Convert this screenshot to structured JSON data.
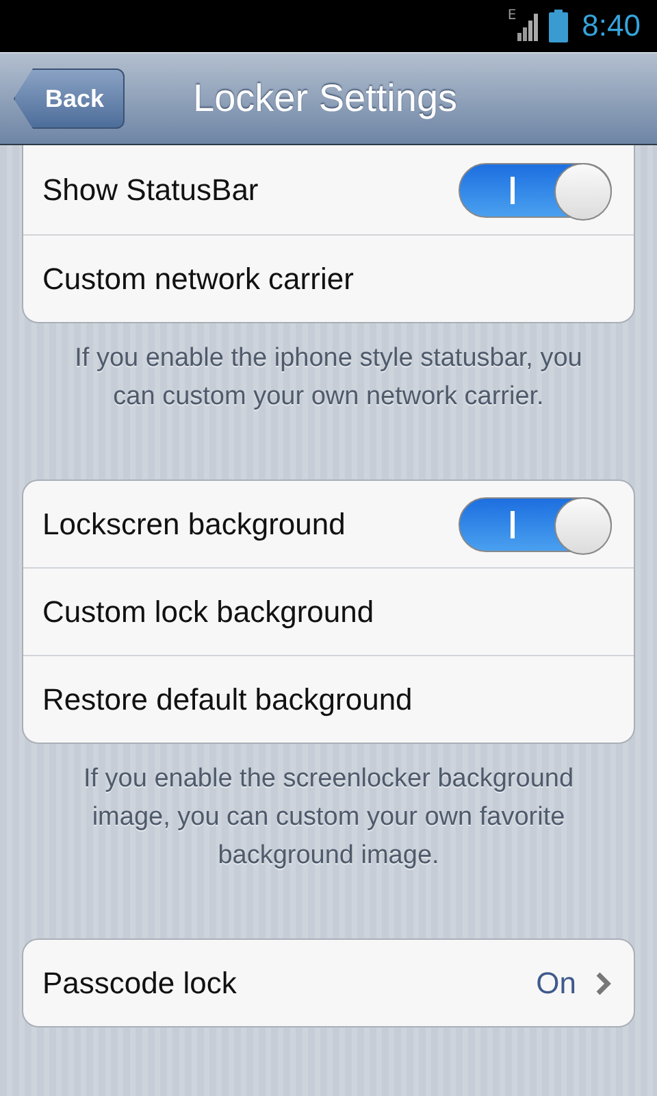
{
  "status_bar": {
    "network": "E",
    "time": "8:40"
  },
  "nav_bar": {
    "back": "Back",
    "title": "Locker Settings"
  },
  "groups": [
    {
      "cut_top": true,
      "rows": [
        {
          "kind": "toggle",
          "label": "Show StatusBar",
          "on": true
        },
        {
          "kind": "link",
          "label": "Custom network carrier"
        }
      ],
      "footer": "If you enable the iphone style statusbar, you can custom your own network carrier."
    },
    {
      "cut_top": false,
      "rows": [
        {
          "kind": "toggle",
          "label": "Lockscren background",
          "on": true
        },
        {
          "kind": "link",
          "label": "Custom lock background"
        },
        {
          "kind": "link",
          "label": "Restore default background"
        }
      ],
      "footer": "If you enable the screenlocker background image, you can custom your own favorite background image."
    },
    {
      "cut_top": false,
      "rows": [
        {
          "kind": "value",
          "label": "Passcode lock",
          "value": "On"
        }
      ]
    }
  ]
}
